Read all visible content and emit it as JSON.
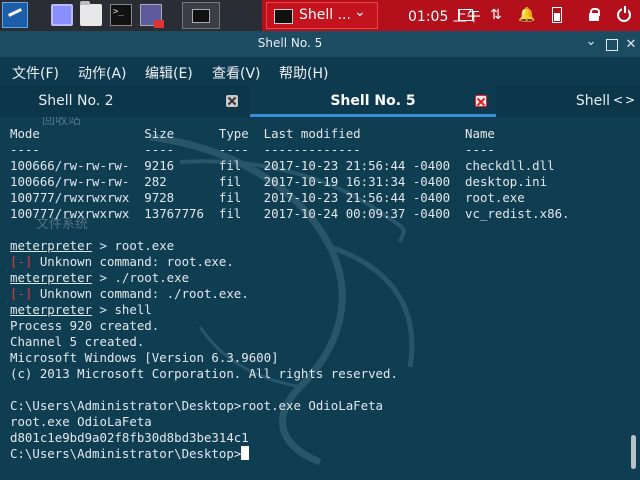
{
  "taskbar": {
    "launchers": [
      "kali-menu",
      "workspace",
      "files",
      "terminal",
      "screen-recorder"
    ],
    "active_task_label": "Shell ...",
    "clock": "01:05 上午"
  },
  "window": {
    "title": "Shell No. 5"
  },
  "menu": [
    "文件(F)",
    "动作(A)",
    "编辑(E)",
    "查看(V)",
    "帮助(H)"
  ],
  "tabs": [
    {
      "label": "Shell No. 2",
      "active": false
    },
    {
      "label": "Shell No. 5",
      "active": true
    },
    {
      "label": "Shell",
      "active": false
    }
  ],
  "desktop_ghosts": [
    "回收站",
    "文件系统"
  ],
  "terminal": {
    "table_header": "Mode              Size      Type  Last modified              Name",
    "table_rule": "----              ----      ----  -------------              ----",
    "rows": [
      "100666/rw-rw-rw-  9216      fil   2017-10-23 21:56:44 -0400  checkdll.dll",
      "100666/rw-rw-rw-  282       fil   2017-10-19 16:31:34 -0400  desktop.ini",
      "100777/rwxrwxrwx  9728      fil   2017-10-23 21:56:44 -0400  root.exe",
      "100777/rwxrwxrwx  13767776  fil   2017-10-24 00:09:37 -0400  vc_redist.x86."
    ],
    "prompt": "meterpreter",
    "cmd1": " > root.exe",
    "err_tag": "[-]",
    "err1": " Unknown command: root.exe.",
    "cmd2": " > ./root.exe",
    "err2": " Unknown command: ./root.exe.",
    "cmd3": " > shell",
    "out1": "Process 920 created.",
    "out2": "Channel 5 created.",
    "out3": "Microsoft Windows [Version 6.3.9600]",
    "out4": "(c) 2013 Microsoft Corporation. All rights reserved.",
    "out5": "C:\\Users\\Administrator\\Desktop>root.exe OdioLaFeta",
    "out6": "root.exe OdioLaFeta",
    "out7": "d801c1e9bd9a02f8fb30d8bd3be314c1",
    "out8": "C:\\Users\\Administrator\\Desktop>"
  },
  "colors": {
    "terminal_bg": "#0f3d52",
    "error": "#e03a3a",
    "taskbar_red": "#b3101b",
    "active_tab_underline": "#3a8ed8"
  }
}
